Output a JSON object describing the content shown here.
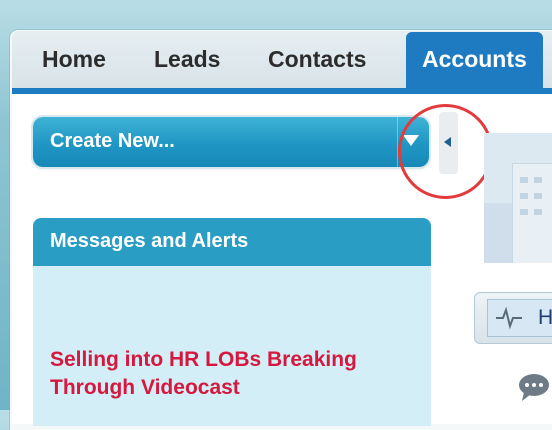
{
  "tabs": [
    {
      "label": "Home",
      "active": false
    },
    {
      "label": "Leads",
      "active": false
    },
    {
      "label": "Contacts",
      "active": false
    },
    {
      "label": "Accounts",
      "active": true
    }
  ],
  "create_new": {
    "label": "Create New..."
  },
  "messages": {
    "title": "Messages and Alerts",
    "link_text": "Selling into HR LOBs Breaking Through Videocast"
  },
  "right_panel": {
    "search_label_partial": "H"
  },
  "colors": {
    "accent_blue": "#1f7bc1",
    "button_blue": "#1f96c4",
    "alert_red": "#d6183f",
    "highlight_red": "#e33b3b"
  },
  "icons": {
    "dropdown": "chevron-down-icon",
    "collapse": "collapse-left-icon",
    "search_pulse": "pulse-icon",
    "chat": "chat-bubble-icon"
  }
}
